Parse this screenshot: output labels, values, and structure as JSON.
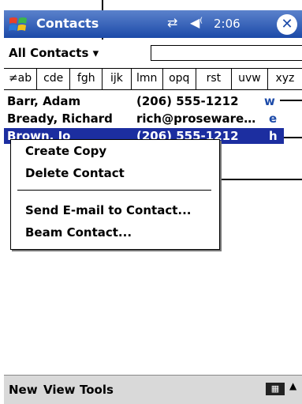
{
  "title_bar": {
    "title": "Contacts",
    "connectivity_icon": "connectivity-icon",
    "speaker_icon": "speaker-icon",
    "time": "2:06",
    "close_label": "✕"
  },
  "filter_bar": {
    "category": "All Contacts",
    "dropdown_arrow": "▾"
  },
  "alpha_tabs": [
    "≠ab",
    "cde",
    "fgh",
    "ijk",
    "lmn",
    "opq",
    "rst",
    "uvw",
    "xyz"
  ],
  "contacts": [
    {
      "name": "Barr, Adam",
      "detail": "(206) 555-1212",
      "tag": "w"
    },
    {
      "name": "Bready, Richard",
      "detail": "rich@proseware…",
      "tag": "e"
    },
    {
      "name": "Brown, Jo",
      "detail": "(206) 555-1212",
      "tag": "h"
    }
  ],
  "context_menu": {
    "items": [
      "Create Copy",
      "Delete Contact",
      "Send E-mail to Contact...",
      "Beam Contact..."
    ]
  },
  "menu_bar": {
    "new": "New",
    "view": "View",
    "tools": "Tools",
    "keyboard_icon": "keyboard-icon",
    "up_arrow": "▲"
  },
  "colors": {
    "title_bar": "#1c4aa8",
    "selection": "#1c2ea0"
  }
}
